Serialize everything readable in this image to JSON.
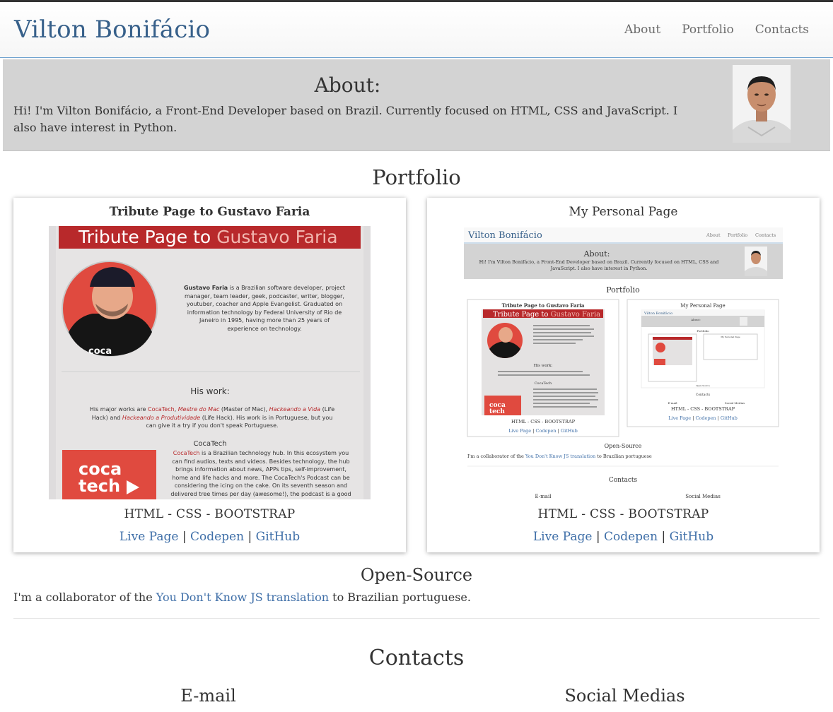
{
  "header": {
    "brand": "Vilton Bonifácio",
    "nav": [
      "About",
      "Portfolio",
      "Contacts"
    ]
  },
  "about": {
    "title": "About:",
    "text": "Hi! I'm Vilton Bonifácio, a Front-End Developer based on Brazil. Currently focused on HTML, CSS and JavaScript. I also have interest in Python."
  },
  "portfolio": {
    "title": "Portfolio",
    "cards": [
      {
        "title": "Tribute Page to Gustavo Faria",
        "tech": "HTML - CSS - BOOTSTRAP",
        "links": [
          "Live Page",
          "Codepen",
          "GitHub"
        ],
        "shot": {
          "heading_a": "Tribute Page to ",
          "heading_b": "Gustavo Faria",
          "bio_name": "Gustavo Faria",
          "bio": " is a Brazilian software developer, project manager, team leader, geek, podcaster, writer, blogger, youtuber, coacher and Apple Evangelist. Graduated on information technology by Federal University of Rio de Janeiro in 1995, having more than 25 years of experience on technology.",
          "work_title": "His work:",
          "work_1": "His major works are ",
          "work_cocatech": "CocaTech",
          "work_sep": ", ",
          "work_mestre": "Mestre do Mac",
          "work_2": " (Master of Mac), ",
          "work_vida": "Hackeando a Vida",
          "work_3": " (Life Hack) and ",
          "work_prod": "Hackeando a Produtividade",
          "work_4": " (Life Hack). His work is in Portuguese, but you can give it a try if you don't speak Portuguese.",
          "cocatech_title": "CocaTech",
          "logo_top": "coca",
          "logo_bottom": "tech",
          "cocatech_link": "CocaTech",
          "cocatech_text": " is a Brazilian technology hub. In this ecosystem you can find audios, texts and videos. Besides technology, the hub brings information about news, APPs tips, self-improvement, home and life hacks and more. The CocaTech's Podcast can be considering the icing on the cake. On its seventh season and delivered tree times per day (awesome!), the podcast is a good companion for your daily routine."
        }
      },
      {
        "title": "My Personal Page",
        "tech": "HTML - CSS - BOOTSTRAP",
        "links": [
          "Live Page",
          "Codepen",
          "GitHub"
        ],
        "shot": {
          "brand": "Vilton Bonifácio",
          "nav": [
            "About",
            "Portfolio",
            "Contacts"
          ],
          "about_title": "About:",
          "about_text": "Hi! I'm Vilton Bonifácio, a Front-End Developer based on Brazil. Currently focused on HTML, CSS and JavaScript. I also have interest in Python.",
          "portfolio_title": "Portfolio",
          "card1_title": "Tribute Page to Gustavo Faria",
          "card1_heading_a": "Tribute Page to ",
          "card1_heading_b": "Gustavo Faria",
          "card1_work": "His work:",
          "card1_cocatech": "CocaTech",
          "card2_title": "My Personal Page",
          "tech": "HTML - CSS - BOOTSTRAP",
          "links": [
            "Live Page",
            "Codepen",
            "GitHub"
          ],
          "mini_brand": "Vilton Bonifácio",
          "mini_about": "About:",
          "mini_portfolio": "Portfolio",
          "mini_card2": "My Personal Page",
          "mini_opensource": "Open-Source",
          "mini_contacts": "Contacts",
          "mini_email": "E-mail",
          "mini_social": "Social Medias",
          "opensource_title": "Open-Source",
          "os_pre": "I'm a collaborator of the ",
          "os_link": "You Don't Know JS translation",
          "os_post": " to Brazilian portuguese",
          "contacts_title": "Contacts",
          "email": "E-mail",
          "social": "Social Medias"
        }
      }
    ]
  },
  "opensource": {
    "title": "Open-Source",
    "text_pre": "I'm a collaborator of the ",
    "link": "You Don't Know JS translation",
    "text_post": " to Brazilian portuguese."
  },
  "contacts": {
    "title": "Contacts",
    "email": "E-mail",
    "social": "Social Medias"
  },
  "colors": {
    "brand": "#37608a",
    "link": "#3f6fa8",
    "about_bg": "#d3d3d3",
    "tribute_red": "#b8292b",
    "cocatech_red": "#e04a3f"
  },
  "icons": [
    "profile-photo",
    "gustavo-photo",
    "cocatech-logo"
  ]
}
